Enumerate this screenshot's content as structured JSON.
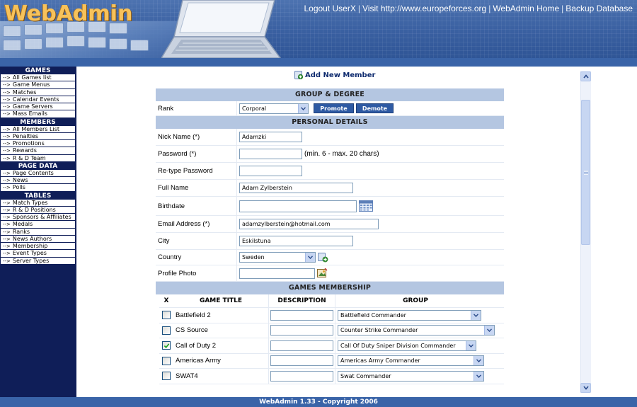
{
  "header": {
    "logo": "WebAdmin",
    "links": [
      "Logout UserX",
      "Visit http://www.europeforces.org",
      "WebAdmin Home",
      "Backup Database"
    ],
    "separator": "|"
  },
  "sidebar": {
    "groups": [
      {
        "title": "GAMES",
        "items": [
          "All Games list",
          "Game Menus",
          "Matches",
          "Calendar Events",
          "Game Servers",
          "Mass Emails"
        ]
      },
      {
        "title": "MEMBERS",
        "items": [
          "All Members List",
          "Penalties",
          "Promotions",
          "Rewards",
          "R & D Team"
        ]
      },
      {
        "title": "PAGE DATA",
        "items": [
          "Page Contents",
          "News",
          "Polls"
        ]
      },
      {
        "title": "TABLES",
        "items": [
          "Match Types",
          "R & D Positions",
          "Sponsors & Affiliates",
          "Medals",
          "Ranks",
          "News Authors",
          "Membership",
          "Event Types",
          "Server Types"
        ]
      }
    ],
    "arrow": "-->"
  },
  "page": {
    "title": "Add New Member"
  },
  "group_degree": {
    "header": "GROUP & DEGREE",
    "rank_label": "Rank",
    "rank_value": "Corporal",
    "promote": "Promote",
    "demote": "Demote"
  },
  "personal": {
    "header": "PERSONAL DETAILS",
    "nick_label": "Nick Name (*)",
    "nick_value": "Adamzki",
    "password_label": "Password (*)",
    "password_value": "",
    "password_hint": "(min. 6 - max. 20 chars)",
    "retype_label": "Re-type Password",
    "retype_value": "",
    "fullname_label": "Full Name",
    "fullname_value": "Adam Zylberstein",
    "birthdate_label": "Birthdate",
    "birthdate_value": "",
    "email_label": "Email Address (*)",
    "email_value": "adamzylberstein@hotmail.com",
    "city_label": "City",
    "city_value": "Eskilstuna",
    "country_label": "Country",
    "country_value": "Sweden",
    "photo_label": "Profile Photo",
    "photo_value": ""
  },
  "games": {
    "header": "GAMES MEMBERSHIP",
    "columns": [
      "X",
      "GAME TITLE",
      "DESCRIPTION",
      "GROUP"
    ],
    "rows": [
      {
        "checked": false,
        "title": "Battlefield 2",
        "description": "",
        "group": "Battlefield Commander"
      },
      {
        "checked": false,
        "title": "CS Source",
        "description": "",
        "group": "Counter Strike Commander"
      },
      {
        "checked": true,
        "title": "Call of Duty 2",
        "description": "",
        "group": "Call Of Duty Sniper Division Commander"
      },
      {
        "checked": false,
        "title": "Americas Army",
        "description": "",
        "group": "Americas Army Commander"
      },
      {
        "checked": false,
        "title": "SWAT4",
        "description": "",
        "group": "Swat Commander"
      }
    ]
  },
  "footer": {
    "text": "WebAdmin 1.33 - Copyright 2006"
  },
  "colors": {
    "header_blue": "#3c62a3",
    "sidebar_navy": "#0f1e58",
    "section_head": "#b4c6e1",
    "button_blue": "#2e5aa3",
    "logo_gold": "#f7c25b"
  }
}
